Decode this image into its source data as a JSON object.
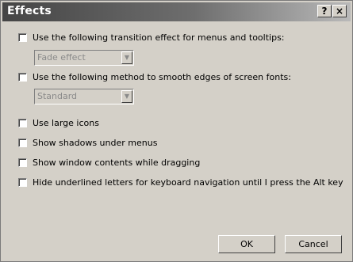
{
  "window": {
    "title": "Effects",
    "help_label": "?",
    "close_label": "×"
  },
  "options": [
    {
      "label": "Use the following transition effect for menus and tooltips:",
      "checked": false
    },
    {
      "label": "Use the following method to smooth edges of screen fonts:",
      "checked": false
    },
    {
      "label": "Use large icons",
      "checked": false
    },
    {
      "label": "Show shadows under menus",
      "checked": false
    },
    {
      "label": "Show window contents while dragging",
      "checked": false
    },
    {
      "label": "Hide underlined letters for keyboard navigation until I press the Alt key",
      "checked": false
    }
  ],
  "transition_select": {
    "value": "Fade effect",
    "enabled": false
  },
  "smoothing_select": {
    "value": "Standard",
    "enabled": false
  },
  "buttons": {
    "ok": "OK",
    "cancel": "Cancel"
  }
}
